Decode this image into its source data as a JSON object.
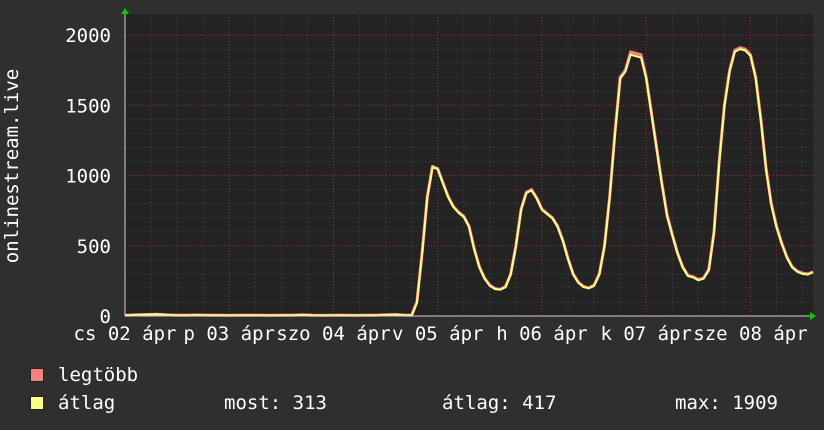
{
  "chart_data": {
    "type": "line",
    "ylabel": "onlinestream.live",
    "ylim": [
      0,
      2150
    ],
    "yticks": [
      0,
      500,
      1000,
      1500,
      2000
    ],
    "xticks": [
      {
        "label": "cs 02 ápr",
        "x": 0
      },
      {
        "label": "p 03 ápr",
        "x": 1
      },
      {
        "label": "szo 04 ápr",
        "x": 2
      },
      {
        "label": "v 05 ápr",
        "x": 3
      },
      {
        "label": "h 06 ápr",
        "x": 4
      },
      {
        "label": "k 07 ápr",
        "x": 5
      },
      {
        "label": "sze 08 ápr",
        "x": 6
      }
    ],
    "xlim": [
      0,
      6.6
    ],
    "grid": true,
    "series": [
      {
        "name": "legtöbb",
        "color": "#ff7f7f",
        "x": [
          0,
          0.1,
          0.2,
          0.3,
          0.4,
          0.5,
          0.6,
          0.7,
          0.8,
          0.9,
          1.0,
          1.1,
          1.2,
          1.3,
          1.4,
          1.5,
          1.6,
          1.7,
          1.8,
          1.9,
          2.0,
          2.1,
          2.2,
          2.3,
          2.4,
          2.5,
          2.6,
          2.7,
          2.75,
          2.8,
          2.85,
          2.9,
          2.95,
          3.0,
          3.05,
          3.1,
          3.15,
          3.2,
          3.25,
          3.3,
          3.35,
          3.4,
          3.45,
          3.5,
          3.55,
          3.6,
          3.65,
          3.7,
          3.75,
          3.8,
          3.85,
          3.9,
          3.95,
          4.0,
          4.05,
          4.1,
          4.15,
          4.2,
          4.25,
          4.3,
          4.35,
          4.4,
          4.45,
          4.5,
          4.55,
          4.6,
          4.65,
          4.7,
          4.75,
          4.8,
          4.85,
          4.9,
          4.95,
          5.0,
          5.05,
          5.1,
          5.15,
          5.2,
          5.25,
          5.3,
          5.35,
          5.4,
          5.45,
          5.5,
          5.55,
          5.6,
          5.65,
          5.7,
          5.75,
          5.8,
          5.85,
          5.9,
          5.95,
          6.0,
          6.05,
          6.1,
          6.15,
          6.2,
          6.25,
          6.3,
          6.35,
          6.4,
          6.45,
          6.5,
          6.55,
          6.6
        ],
        "values": [
          5,
          8,
          10,
          12,
          8,
          6,
          5,
          7,
          6,
          5,
          4,
          5,
          6,
          5,
          4,
          5,
          6,
          8,
          5,
          4,
          5,
          6,
          4,
          5,
          6,
          8,
          10,
          6,
          5,
          100,
          450,
          850,
          1065,
          1050,
          950,
          850,
          780,
          740,
          710,
          640,
          480,
          350,
          270,
          220,
          195,
          190,
          210,
          300,
          500,
          760,
          880,
          900,
          840,
          760,
          730,
          700,
          640,
          540,
          410,
          300,
          240,
          210,
          200,
          220,
          300,
          500,
          850,
          1300,
          1700,
          1750,
          1880,
          1870,
          1860,
          1700,
          1450,
          1200,
          950,
          720,
          580,
          450,
          350,
          290,
          280,
          260,
          270,
          330,
          600,
          1100,
          1500,
          1750,
          1890,
          1910,
          1900,
          1860,
          1700,
          1400,
          1050,
          800,
          640,
          520,
          420,
          350,
          320,
          305,
          300,
          313
        ]
      },
      {
        "name": "átlag",
        "color": "#ffff80",
        "x": [
          0,
          0.1,
          0.2,
          0.3,
          0.4,
          0.5,
          0.6,
          0.7,
          0.8,
          0.9,
          1.0,
          1.1,
          1.2,
          1.3,
          1.4,
          1.5,
          1.6,
          1.7,
          1.8,
          1.9,
          2.0,
          2.1,
          2.2,
          2.3,
          2.4,
          2.5,
          2.6,
          2.7,
          2.75,
          2.8,
          2.85,
          2.9,
          2.95,
          3.0,
          3.05,
          3.1,
          3.15,
          3.2,
          3.25,
          3.3,
          3.35,
          3.4,
          3.45,
          3.5,
          3.55,
          3.6,
          3.65,
          3.7,
          3.75,
          3.8,
          3.85,
          3.9,
          3.95,
          4.0,
          4.05,
          4.1,
          4.15,
          4.2,
          4.25,
          4.3,
          4.35,
          4.4,
          4.45,
          4.5,
          4.55,
          4.6,
          4.65,
          4.7,
          4.75,
          4.8,
          4.85,
          4.9,
          4.95,
          5.0,
          5.05,
          5.1,
          5.15,
          5.2,
          5.25,
          5.3,
          5.35,
          5.4,
          5.45,
          5.5,
          5.55,
          5.6,
          5.65,
          5.7,
          5.75,
          5.8,
          5.85,
          5.9,
          5.95,
          6.0,
          6.05,
          6.1,
          6.15,
          6.2,
          6.25,
          6.3,
          6.35,
          6.4,
          6.45,
          6.5,
          6.55,
          6.6
        ],
        "values": [
          5,
          8,
          10,
          12,
          8,
          6,
          5,
          7,
          6,
          5,
          4,
          5,
          6,
          5,
          4,
          5,
          6,
          8,
          5,
          4,
          5,
          6,
          4,
          5,
          6,
          8,
          10,
          6,
          5,
          95,
          440,
          840,
          1060,
          1045,
          945,
          845,
          775,
          735,
          705,
          635,
          475,
          345,
          265,
          215,
          192,
          188,
          205,
          295,
          495,
          755,
          875,
          895,
          835,
          755,
          725,
          695,
          635,
          535,
          405,
          295,
          235,
          205,
          198,
          215,
          295,
          495,
          845,
          1290,
          1690,
          1740,
          1860,
          1850,
          1840,
          1690,
          1440,
          1190,
          940,
          710,
          575,
          445,
          345,
          285,
          275,
          255,
          265,
          325,
          590,
          1090,
          1490,
          1740,
          1880,
          1900,
          1890,
          1850,
          1690,
          1390,
          1040,
          790,
          630,
          515,
          415,
          345,
          315,
          300,
          295,
          313
        ]
      }
    ]
  },
  "legend": [
    {
      "name": "legtöbb",
      "color": "#ff7f7f"
    },
    {
      "name": "átlag",
      "color": "#ffff80"
    }
  ],
  "stats": {
    "most": "most: 313",
    "atlag": "átlag: 417",
    "max": "max: 1909"
  }
}
